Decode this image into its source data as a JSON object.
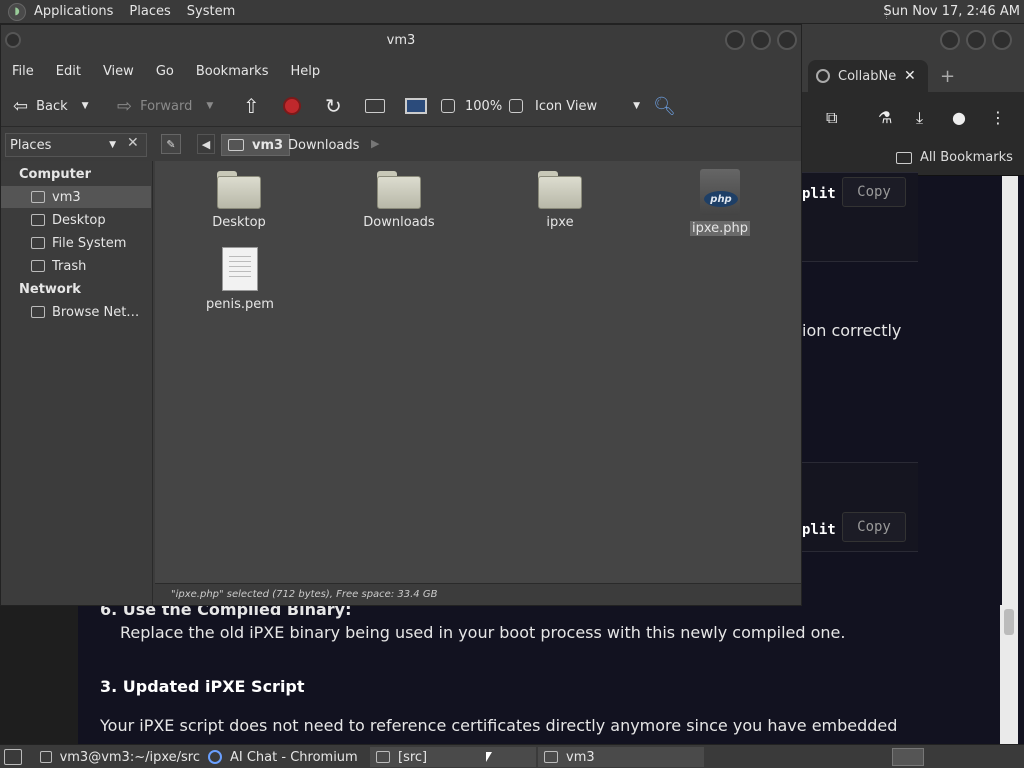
{
  "top_panel": {
    "menus": [
      "Applications",
      "Places",
      "System"
    ],
    "clock": "Sun Nov 17,  2:46 AM"
  },
  "chromium": {
    "tab_label": "CollabNe",
    "tab_close": "✕",
    "new_tab": "+",
    "bookmarks_label": "All Bookmarks",
    "split_label": "plit",
    "copy_label": "Copy",
    "partial_text": "ion correctly",
    "step6_title": "6. Use the Compiled Binary:",
    "step6_body": "Replace the old iPXE binary being used in your boot process with this newly compiled one.",
    "section3_heading": "3. Updated iPXE Script",
    "section3_body": "Your iPXE script does not need to reference certificates directly anymore since you have embedded"
  },
  "nautilus": {
    "title": "vm3",
    "menu": [
      "File",
      "Edit",
      "View",
      "Go",
      "Bookmarks",
      "Help"
    ],
    "toolbar": {
      "back": "Back",
      "forward": "Forward",
      "zoom": "100%",
      "view_mode": "Icon View"
    },
    "places_label": "Places",
    "path": [
      "vm3",
      "Downloads"
    ],
    "sidebar": {
      "computer_heading": "Computer",
      "computer_items": [
        "vm3",
        "Desktop",
        "File System",
        "Trash"
      ],
      "network_heading": "Network",
      "network_items": [
        "Browse Net…"
      ]
    },
    "files": [
      {
        "name": "Desktop",
        "type": "folder"
      },
      {
        "name": "Downloads",
        "type": "folder"
      },
      {
        "name": "ipxe",
        "type": "folder"
      },
      {
        "name": "ipxe.php",
        "type": "php"
      },
      {
        "name": "penis.pem",
        "type": "doc"
      }
    ],
    "status": "\"ipxe.php\" selected (712 bytes), Free space: 33.4 GB"
  },
  "taskbar": {
    "tasks": [
      "vm3@vm3:~/ipxe/src",
      "AI Chat - Chromium",
      "[src]",
      "vm3"
    ]
  }
}
